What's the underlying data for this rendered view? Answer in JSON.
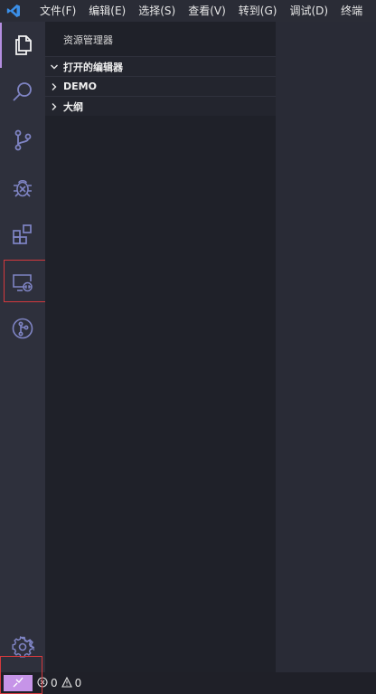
{
  "menu": {
    "items": [
      {
        "label": "文件(F)"
      },
      {
        "label": "编辑(E)"
      },
      {
        "label": "选择(S)"
      },
      {
        "label": "查看(V)"
      },
      {
        "label": "转到(G)"
      },
      {
        "label": "调试(D)"
      },
      {
        "label": "终端"
      }
    ]
  },
  "activity": {
    "icons": [
      "explorer-icon",
      "search-icon",
      "source-control-icon",
      "debug-icon",
      "extensions-icon",
      "remote-explorer-icon",
      "git-graph-icon",
      "settings-gear-icon"
    ],
    "accent": "#b48ee0"
  },
  "sidebar": {
    "title": "资源管理器",
    "sections": [
      {
        "label": "打开的编辑器",
        "expanded": true
      },
      {
        "label": "DEMO",
        "expanded": false
      },
      {
        "label": "大纲",
        "expanded": false
      }
    ]
  },
  "status": {
    "remote_color": "#c694e8",
    "errors": "0",
    "warnings": "0"
  },
  "colors": {
    "highlight_border": "#d3393d",
    "vscode_blue": "#3b8fe8"
  }
}
